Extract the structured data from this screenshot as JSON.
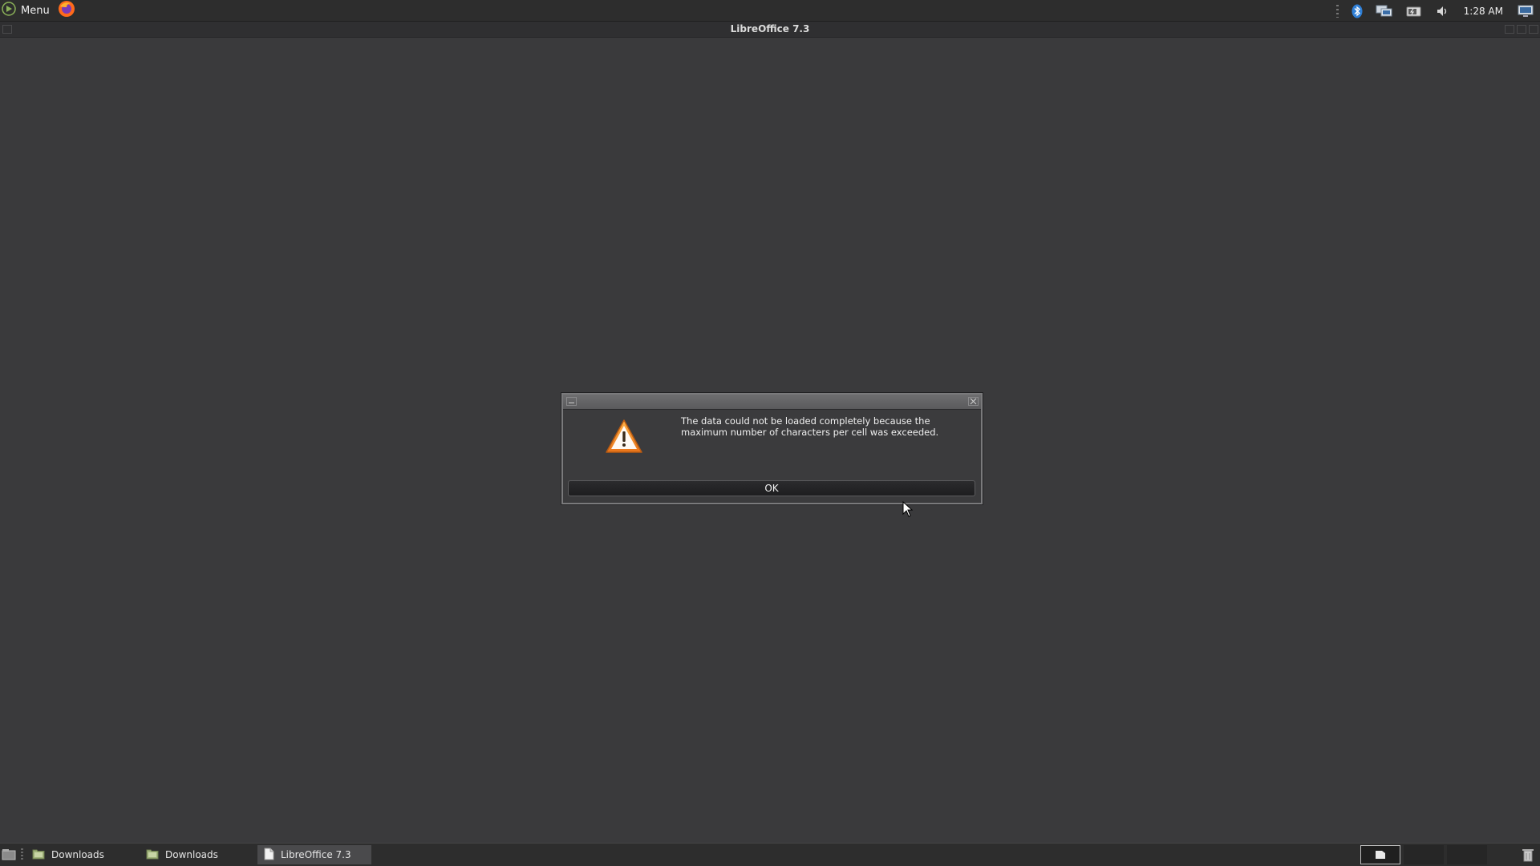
{
  "top_panel": {
    "menu_label": "Menu",
    "clock": "1:28 AM",
    "icons": [
      "mint-menu-icon",
      "firefox-icon",
      "bluetooth-icon",
      "network-icon",
      "battery-icon",
      "volume-icon",
      "display-icon"
    ]
  },
  "window": {
    "title": "LibreOffice 7.3"
  },
  "dialog": {
    "message": "The data could not be loaded completely because the maximum number of characters per cell was exceeded.",
    "ok_label": "OK",
    "icon": "warning-icon",
    "accent": "#f08a1c"
  },
  "taskbar": {
    "tasks": [
      {
        "label": "Downloads",
        "icon": "folder-icon"
      },
      {
        "label": "Downloads",
        "icon": "folder-icon"
      },
      {
        "label": "LibreOffice 7.3",
        "icon": "document-icon"
      }
    ]
  }
}
